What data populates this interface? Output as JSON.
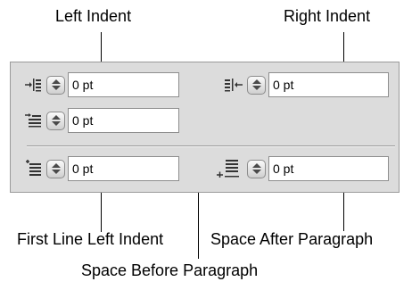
{
  "callouts": {
    "left_indent": "Left Indent",
    "right_indent": "Right Indent",
    "first_line_left_indent": "First Line Left Indent",
    "space_after_paragraph": "Space After Paragraph",
    "space_before_paragraph": "Space Before Paragraph"
  },
  "fields": {
    "left_indent": "0 pt",
    "right_indent": "0 pt",
    "first_line_left_indent": "0 pt",
    "space_before": "0 pt",
    "space_after": "0 pt"
  },
  "icons": {
    "left_indent": "left-indent-icon",
    "right_indent": "right-indent-icon",
    "first_line_left_indent": "first-line-indent-icon",
    "space_before": "space-before-icon",
    "space_after": "space-after-icon"
  },
  "colors": {
    "panel_bg": "#dcdcdc",
    "field_border": "#8e8e8e"
  }
}
